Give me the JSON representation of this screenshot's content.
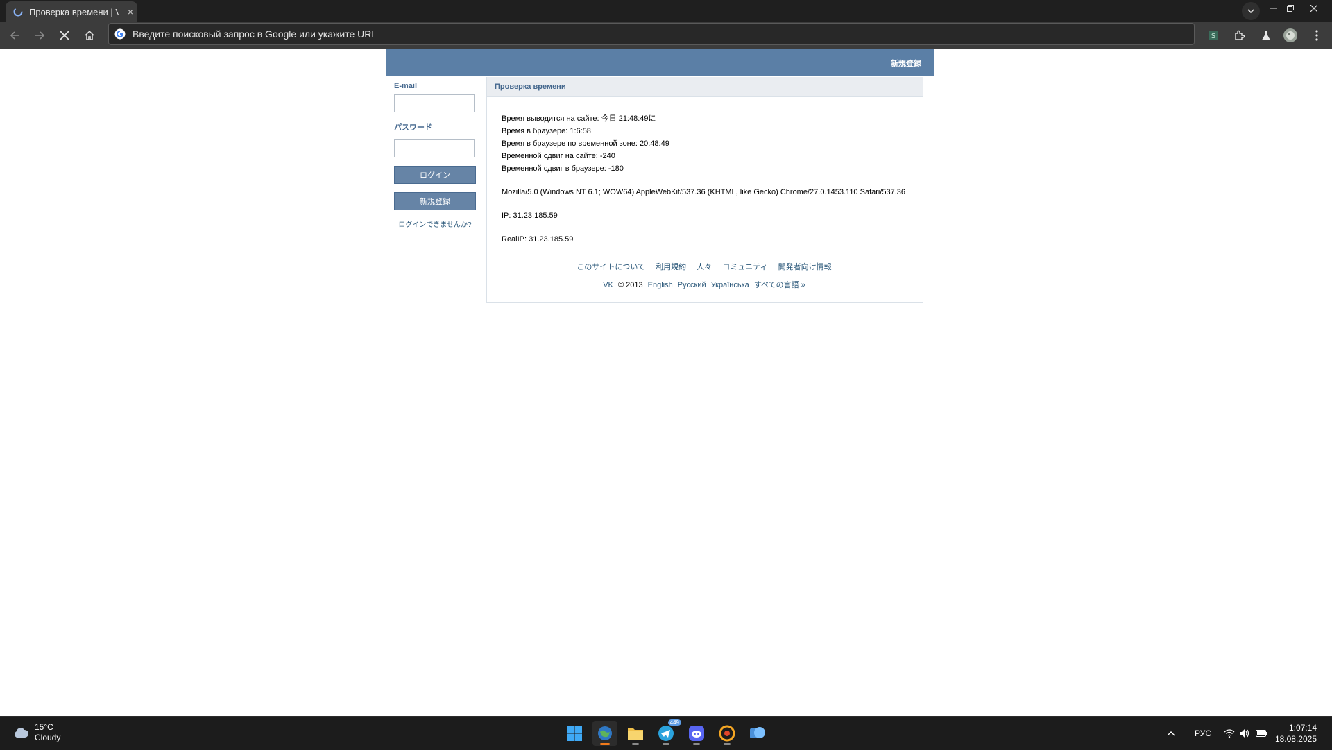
{
  "browser": {
    "tab_title": "Проверка времени | V",
    "tab_close": "×",
    "omnibox_placeholder": "Введите поисковый запрос в Google или укажите URL"
  },
  "vk": {
    "header_link": "新規登録",
    "sidebar": {
      "email_label": "E-mail",
      "password_label": "パスワード",
      "login_button": "ログイン",
      "register_button": "新規登録",
      "forgot_link": "ログインできませんか?"
    },
    "content": {
      "title": "Проверка времени",
      "lines": [
        "Время выводится на сайте: 今日 21:48:49に",
        "Время в браузере: 1:6:58",
        "Время в браузере по временной зоне: 20:48:49",
        "Временной сдвиг на сайте: -240",
        "Временной сдвиг в браузере: -180"
      ],
      "user_agent": "Mozilla/5.0 (Windows NT 6.1; WOW64) AppleWebKit/537.36 (KHTML, like Gecko) Chrome/27.0.1453.110 Safari/537.36",
      "ip": "IP: 31.23.185.59",
      "real_ip": "RealIP: 31.23.185.59"
    },
    "footer": {
      "links": [
        "このサイトについて",
        "利用規約",
        "人々",
        "コミュニティ",
        "開発者向け情報"
      ],
      "brand": "VK",
      "copyright": "© 2013",
      "languages": [
        "English",
        "Русский",
        "Українська",
        "すべての言語 »"
      ]
    },
    "colors": {
      "header": "#5b7fa6",
      "link": "#2b587a",
      "button": "#6684a6"
    }
  },
  "taskbar": {
    "weather_temp": "15°C",
    "weather_desc": "Cloudy",
    "telegram_badge": "449",
    "language": "РУС",
    "time": "1:07:14",
    "date": "18.08.2025"
  }
}
